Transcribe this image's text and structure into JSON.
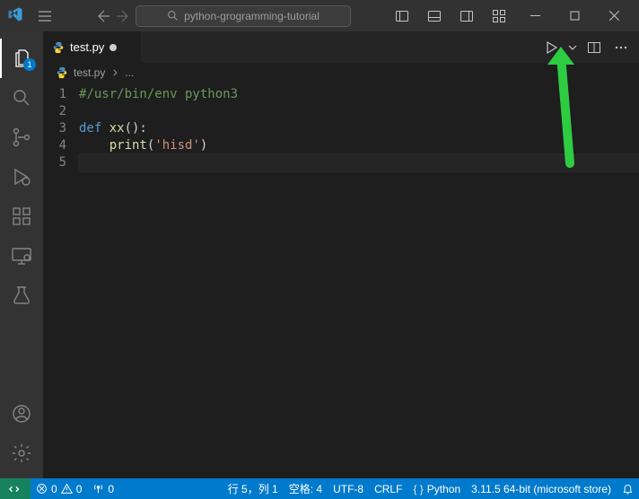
{
  "command_center": {
    "text": "python-grogramming-tutorial"
  },
  "tabs": [
    {
      "label": "test.py"
    }
  ],
  "breadcrumbs": {
    "file": "test.py",
    "suffix": "..."
  },
  "activity_badge": {
    "explorer": "1"
  },
  "code": {
    "line1_comment": "#/usr/bin/env python3",
    "line3_def": "def ",
    "line3_name": "xx",
    "line3_after": "():",
    "line4_indent": "    ",
    "line4_print": "print",
    "line4_open": "(",
    "line4_string": "'hisd'",
    "line4_close": ")",
    "gutter": [
      "1",
      "2",
      "3",
      "4",
      "5"
    ]
  },
  "status": {
    "errors": "0",
    "warnings": "0",
    "ports": "0",
    "cursor": "行 5，列 1",
    "spaces": "空格: 4",
    "encoding": "UTF-8",
    "eol": "CRLF",
    "lang": "Python",
    "interpreter": "3.11.5 64-bit (microsoft store)"
  }
}
